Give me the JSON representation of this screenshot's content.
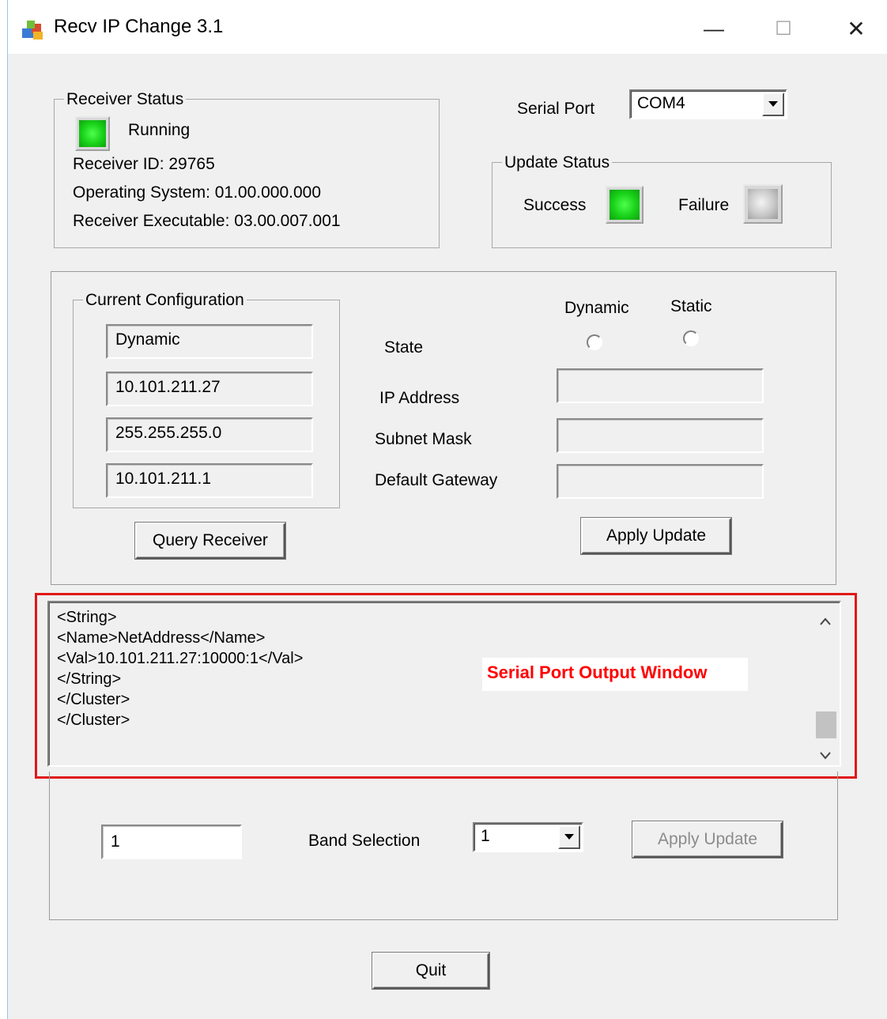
{
  "window": {
    "title": "Recv IP Change 3.1",
    "minimize_glyph": "—",
    "maximize_glyph": "☐",
    "close_glyph": "✕"
  },
  "receiver_status": {
    "legend": "Receiver Status",
    "state": "Running",
    "receiver_id": "Receiver ID: 29765",
    "operating_system": "Operating System: 01.00.000.000",
    "receiver_executable": "Receiver Executable: 03.00.007.001",
    "led_color": "#19d119"
  },
  "serial_port": {
    "label": "Serial Port",
    "selected": "COM4"
  },
  "update_status": {
    "legend": "Update Status",
    "success_label": "Success",
    "failure_label": "Failure",
    "success_led_color": "#19d119",
    "failure_led_color": "#c8c8c8"
  },
  "current_configuration": {
    "legend": "Current Configuration",
    "state_value": "Dynamic",
    "ip_value": "10.101.211.27",
    "subnet_value": "255.255.255.0",
    "gateway_value": "10.101.211.1",
    "query_button": "Query Receiver"
  },
  "new_configuration": {
    "dynamic_label": "Dynamic",
    "static_label": "Static",
    "state_label": "State",
    "ip_label": "IP Address",
    "subnet_label": "Subnet Mask",
    "gateway_label": "Default Gateway",
    "ip_value": "",
    "subnet_value": "",
    "gateway_value": "",
    "apply_button": "Apply Update"
  },
  "output": {
    "lines": [
      "<String>",
      "<Name>NetAddress</Name>",
      "<Val>10.101.211.27:10000:1</Val>",
      "</String>",
      "</Cluster>",
      "</Cluster>"
    ],
    "annotation": "Serial Port Output Window",
    "annotation_color": "#ff0000"
  },
  "band": {
    "input_value": "1",
    "label": "Band Selection",
    "selected": "1",
    "apply_button": "Apply Update"
  },
  "quit_button": "Quit"
}
